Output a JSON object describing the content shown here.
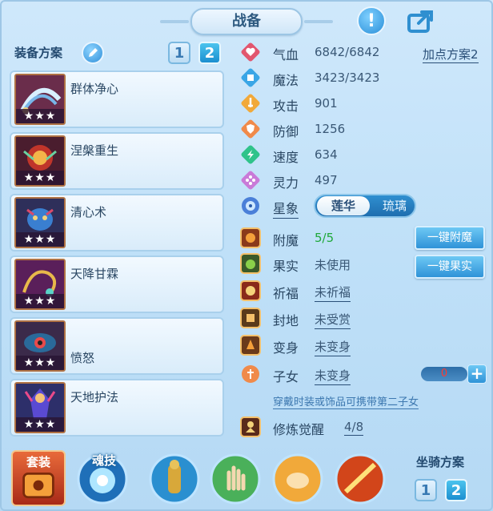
{
  "header": {
    "title": "战备",
    "alert_symbol": "!"
  },
  "left": {
    "plan_label": "装备方案",
    "plan_buttons": [
      "1",
      "2"
    ],
    "skills": [
      {
        "name": "群体净心",
        "stars": "★★★",
        "icon": "fan-feathers-icon"
      },
      {
        "name": "涅槃重生",
        "stars": "★★★",
        "icon": "phoenix-orb-icon"
      },
      {
        "name": "清心术",
        "stars": "★★★",
        "icon": "blue-mask-icon"
      },
      {
        "name": "天降甘霖",
        "stars": "★★★",
        "icon": "chain-whip-icon"
      },
      {
        "name": "愤怒",
        "stars": "★★★",
        "icon": "eye-monster-icon"
      },
      {
        "name": "天地护法",
        "stars": "★★★",
        "icon": "guardian-warrior-icon"
      }
    ]
  },
  "stats": {
    "add_plan": "加点方案2",
    "rows": [
      {
        "label": "气血",
        "value": "6842/6842",
        "icon": "heart-icon"
      },
      {
        "label": "魔法",
        "value": "3423/3423",
        "icon": "magic-icon"
      },
      {
        "label": "攻击",
        "value": "901",
        "icon": "sword-icon"
      },
      {
        "label": "防御",
        "value": "1256",
        "icon": "shield-icon"
      },
      {
        "label": "速度",
        "value": "634",
        "icon": "speed-icon"
      },
      {
        "label": "灵力",
        "value": "497",
        "icon": "spirit-icon"
      }
    ],
    "star_label": "星象",
    "star_options": [
      "莲华",
      "琉璃"
    ],
    "star_selected": "莲华"
  },
  "extras": {
    "rows": [
      {
        "label": "附魔",
        "value": "5/5"
      },
      {
        "label": "果实",
        "value": "未使用"
      },
      {
        "label": "祈福",
        "value": "未祈福"
      },
      {
        "label": "封地",
        "value": "未受赏"
      },
      {
        "label": "变身",
        "value": "未变身"
      },
      {
        "label": "子女",
        "value": "未变身"
      }
    ],
    "btn_enchant": "一键附魔",
    "btn_fruit": "一键果实",
    "child_count": "0",
    "plus": "+",
    "note": "穿戴时装或饰品可携带第二子女",
    "awaken_label": "修炼觉醒",
    "awaken_value": "4/8"
  },
  "bottom": {
    "suit_label": "套装",
    "soul_label": "魂技",
    "mount_label": "坐骑方案",
    "mount_buttons": [
      "1",
      "2"
    ]
  },
  "colors": {
    "accent": "#2f93d8",
    "enchant_value": "#1fa83a",
    "child_count": "#ff3b30"
  }
}
